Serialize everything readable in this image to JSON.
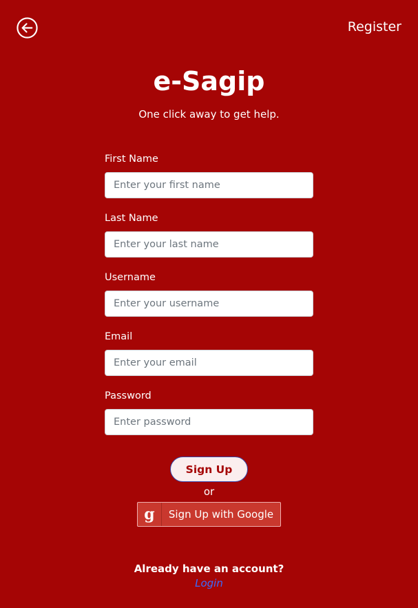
{
  "header": {
    "back_icon": "arrow-left-circle-icon",
    "register_label": "Register"
  },
  "brand": {
    "title": "e-Sagip",
    "subtitle": "One click away to get help."
  },
  "form": {
    "fields": [
      {
        "label": "First Name",
        "placeholder": "Enter your first name",
        "value": ""
      },
      {
        "label": "Last Name",
        "placeholder": "Enter your last name",
        "value": ""
      },
      {
        "label": "Username",
        "placeholder": "Enter your username",
        "value": ""
      },
      {
        "label": "Email",
        "placeholder": "Enter your email",
        "value": ""
      },
      {
        "label": "Password",
        "placeholder": "Enter password",
        "value": ""
      }
    ],
    "signup_label": "Sign Up",
    "or_text": "or",
    "google_icon": "google-g-icon",
    "google_icon_glyph": "g",
    "google_label": "Sign Up with Google"
  },
  "footer": {
    "prompt": "Already have an account?",
    "login_label": "Login"
  },
  "colors": {
    "background": "#a50505",
    "signup_bg": "#fbeeee",
    "google_bg": "#c9382e",
    "link": "#3b6cff"
  }
}
